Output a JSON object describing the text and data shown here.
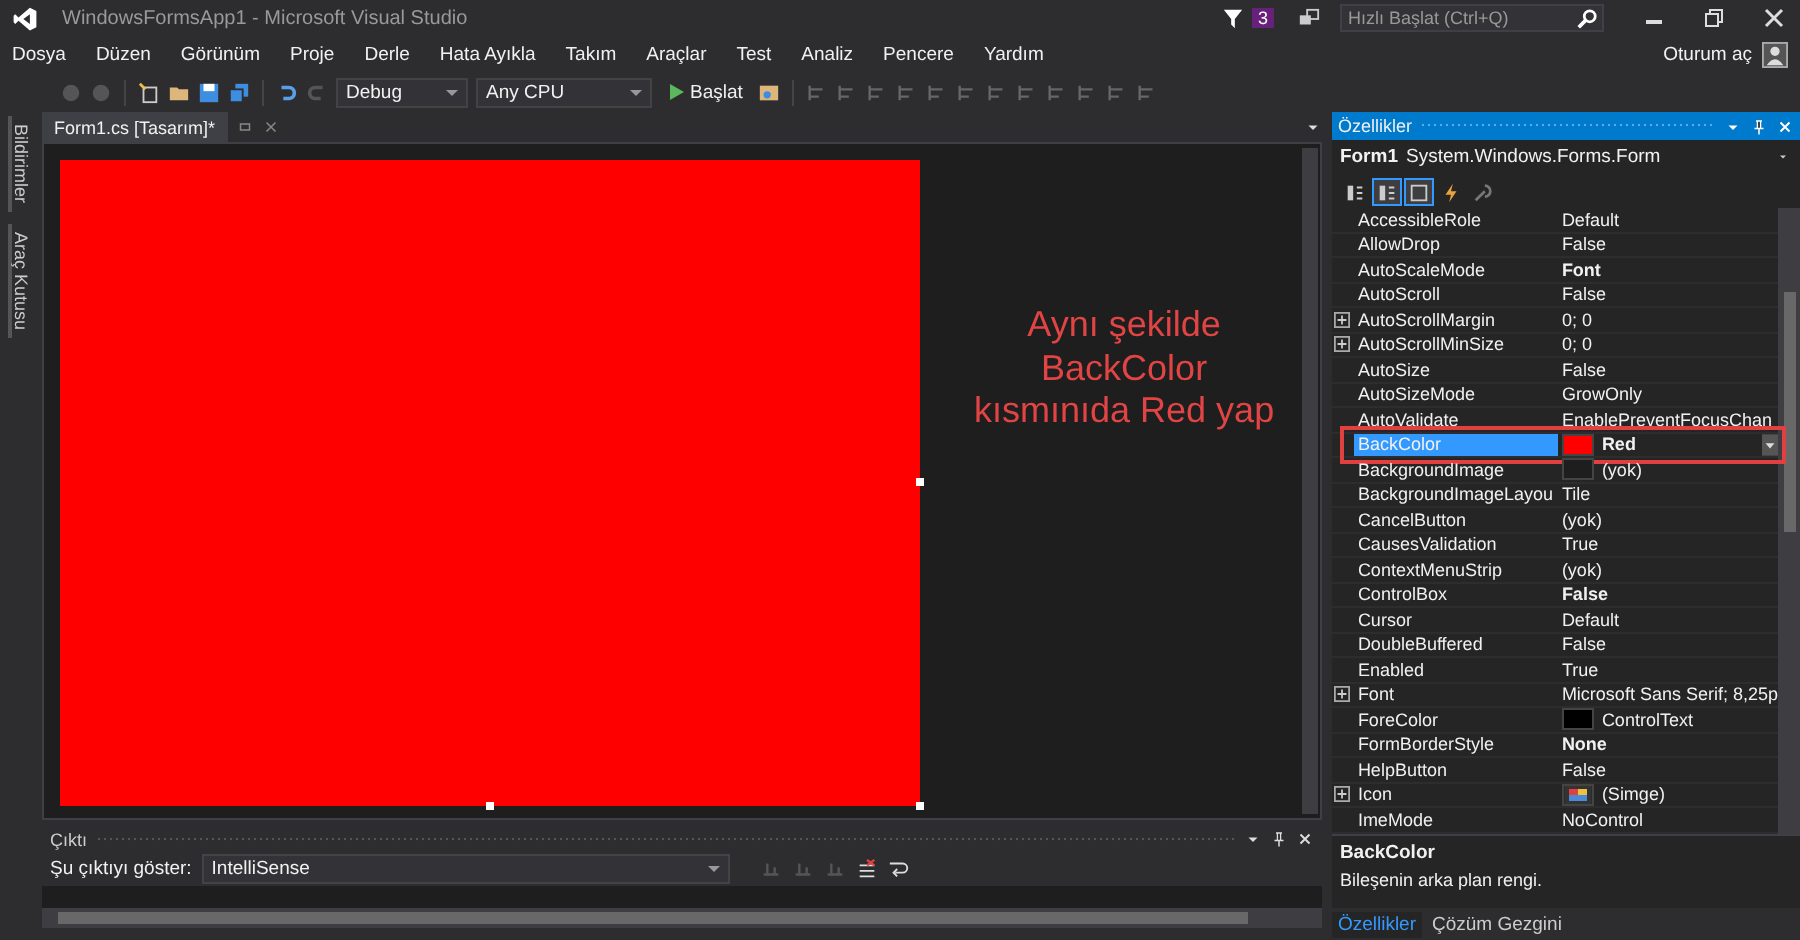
{
  "window": {
    "title": "WindowsFormsApp1 - Microsoft Visual Studio",
    "notification_count": "3",
    "quick_launch": {
      "placeholder": "Hızlı Başlat (Ctrl+Q)"
    }
  },
  "menu": [
    "Dosya",
    "Düzen",
    "Görünüm",
    "Proje",
    "Derle",
    "Hata Ayıkla",
    "Takım",
    "Araçlar",
    "Test",
    "Analiz",
    "Pencere",
    "Yardım"
  ],
  "sign_in": "Oturum aç",
  "toolbar": {
    "configuration": "Debug",
    "platform": "Any CPU",
    "start": "Başlat"
  },
  "side_tabs": [
    "Bildirimler",
    "Araç Kutusu"
  ],
  "document_tab": {
    "title": "Form1.cs [Tasarım]*"
  },
  "form": {
    "color": "#ff0000"
  },
  "annotation": "Aynı şekilde BackColor kısmınıda Red yap",
  "output": {
    "title": "Çıktı",
    "label": "Şu çıktıyı göster:",
    "source": "IntelliSense"
  },
  "properties": {
    "title": "Özellikler",
    "object": "Form1",
    "type": "System.Windows.Forms.Form",
    "toolbar": [
      {
        "selected": false
      },
      {
        "selected": true
      },
      {
        "selected": true
      },
      {
        "selected": false
      },
      {
        "selected": false
      }
    ],
    "rows": [
      {
        "name": "AccessibleRole",
        "value": "Default",
        "kind": "text",
        "bold": false,
        "expandable": false,
        "selected": false
      },
      {
        "name": "AllowDrop",
        "value": "False",
        "kind": "text",
        "bold": false,
        "expandable": false,
        "selected": false
      },
      {
        "name": "AutoScaleMode",
        "value": "Font",
        "kind": "text",
        "bold": true,
        "expandable": false,
        "selected": false
      },
      {
        "name": "AutoScroll",
        "value": "False",
        "kind": "text",
        "bold": false,
        "expandable": false,
        "selected": false
      },
      {
        "name": "AutoScrollMargin",
        "value": "0; 0",
        "kind": "text",
        "bold": false,
        "expandable": true,
        "selected": false
      },
      {
        "name": "AutoScrollMinSize",
        "value": "0; 0",
        "kind": "text",
        "bold": false,
        "expandable": true,
        "selected": false
      },
      {
        "name": "AutoSize",
        "value": "False",
        "kind": "text",
        "bold": false,
        "expandable": false,
        "selected": false
      },
      {
        "name": "AutoSizeMode",
        "value": "GrowOnly",
        "kind": "text",
        "bold": false,
        "expandable": false,
        "selected": false
      },
      {
        "name": "AutoValidate",
        "value": "EnablePreventFocusChan",
        "kind": "text",
        "bold": false,
        "expandable": false,
        "selected": false
      },
      {
        "name": "BackColor",
        "value": "Red",
        "kind": "color",
        "color": "#ff0000",
        "bold": true,
        "expandable": false,
        "selected": true,
        "highlighted": true
      },
      {
        "name": "BackgroundImage",
        "value": "(yok)",
        "kind": "color",
        "color": "#1e1e1e",
        "bold": false,
        "expandable": false,
        "selected": false
      },
      {
        "name": "BackgroundImageLayou",
        "value": "Tile",
        "kind": "text",
        "bold": false,
        "expandable": false,
        "selected": false
      },
      {
        "name": "CancelButton",
        "value": "(yok)",
        "kind": "text",
        "bold": false,
        "expandable": false,
        "selected": false
      },
      {
        "name": "CausesValidation",
        "value": "True",
        "kind": "text",
        "bold": false,
        "expandable": false,
        "selected": false
      },
      {
        "name": "ContextMenuStrip",
        "value": "(yok)",
        "kind": "text",
        "bold": false,
        "expandable": false,
        "selected": false
      },
      {
        "name": "ControlBox",
        "value": "False",
        "kind": "text",
        "bold": true,
        "expandable": false,
        "selected": false
      },
      {
        "name": "Cursor",
        "value": "Default",
        "kind": "text",
        "bold": false,
        "expandable": false,
        "selected": false
      },
      {
        "name": "DoubleBuffered",
        "value": "False",
        "kind": "text",
        "bold": false,
        "expandable": false,
        "selected": false
      },
      {
        "name": "Enabled",
        "value": "True",
        "kind": "text",
        "bold": false,
        "expandable": false,
        "selected": false
      },
      {
        "name": "Font",
        "value": "Microsoft Sans Serif; 8,25p",
        "kind": "text",
        "bold": false,
        "expandable": true,
        "selected": false
      },
      {
        "name": "ForeColor",
        "value": "ControlText",
        "kind": "color",
        "color": "#000000",
        "bold": false,
        "expandable": false,
        "selected": false
      },
      {
        "name": "FormBorderStyle",
        "value": "None",
        "kind": "text",
        "bold": true,
        "expandable": false,
        "selected": false
      },
      {
        "name": "HelpButton",
        "value": "False",
        "kind": "text",
        "bold": false,
        "expandable": false,
        "selected": false
      },
      {
        "name": "Icon",
        "value": "(Simge)",
        "kind": "image",
        "bold": false,
        "expandable": true,
        "selected": false
      },
      {
        "name": "ImeMode",
        "value": "NoControl",
        "kind": "text",
        "bold": false,
        "expandable": false,
        "selected": false
      }
    ],
    "description": {
      "title": "BackColor",
      "text": "Bileşenin arka plan rengi."
    }
  },
  "bottom_tabs": [
    {
      "label": "Özellikler",
      "selected": true
    },
    {
      "label": "Çözüm Gezgini",
      "selected": false
    }
  ]
}
